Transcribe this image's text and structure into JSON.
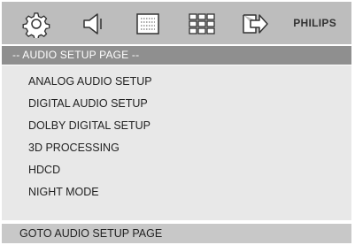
{
  "topbar": {
    "icons": [
      "gear-icon",
      "speaker-icon",
      "screen-icon",
      "grid-icon",
      "exit-icon"
    ],
    "brand": "PHILIPS"
  },
  "page": {
    "title": "-- AUDIO SETUP PAGE --"
  },
  "menu": {
    "items": [
      "ANALOG AUDIO SETUP",
      "DIGITAL AUDIO SETUP",
      "DOLBY DIGITAL SETUP",
      "3D PROCESSING",
      "HDCD",
      "NIGHT MODE"
    ]
  },
  "status": {
    "text": "GOTO AUDIO SETUP PAGE"
  },
  "colors": {
    "topbar": "#bdbdbd",
    "pagebar": "#8f8f8f",
    "menu_bg": "#e8e8e8",
    "statusbar": "#c8c8c8"
  }
}
